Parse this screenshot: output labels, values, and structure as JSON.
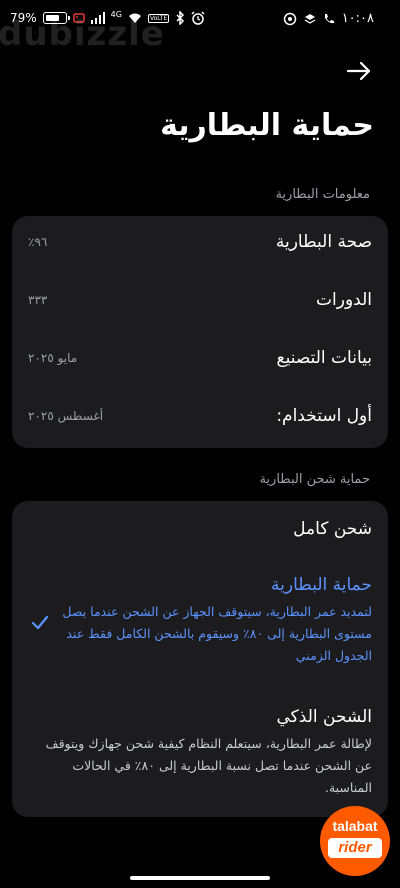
{
  "status": {
    "battery_percent": 79,
    "battery_label": "79%",
    "network_label": "4G",
    "volte_label": "VoLTE",
    "time": "١٠:٠٨",
    "icons": [
      "battery-icon",
      "battery-saver-icon",
      "gallery-icon",
      "signal-icon",
      "wifi-icon",
      "volte-icon",
      "bluetooth-icon",
      "alarm-icon",
      "whatsapp-icon",
      "layers-icon",
      "phone-icon"
    ]
  },
  "watermark": "dubizzle",
  "header": {
    "title": "حماية البطارية"
  },
  "battery_info": {
    "section_label": "معلومات البطارية",
    "rows": [
      {
        "label": "صحة البطارية",
        "value": "٩٦٪"
      },
      {
        "label": "الدورات",
        "value": "٣٣٣"
      },
      {
        "label": "بيانات التصنيع",
        "value": "مايو ٢٠٢٥"
      },
      {
        "label": "أول استخدام:",
        "value": "أغسطس ٢٠٢٥"
      }
    ]
  },
  "charging_protection": {
    "section_label": "حماية شحن البطارية",
    "options": [
      {
        "title": "شحن كامل",
        "desc_lines": []
      },
      {
        "title": "حماية البطارية",
        "selected": true,
        "desc_lines": [
          "لتمديد عمر البطارية، سيتوقف الجهاز عن الشحن عندما يصل",
          "مستوى البطارية إلى ٨٠٪ وسيقوم بالشحن الكامل فقط عند",
          "الجدول الزمني"
        ]
      },
      {
        "title": "الشحن الذكي",
        "desc_lines": [
          "لإطالة عمر البطارية، سيتعلم النظام كيفية شحن جهازك ويتوقف",
          "عن الشحن عندما تصل نسبة البطارية إلى ٨٠٪ في الحالات",
          "المناسبة."
        ]
      }
    ]
  },
  "overlay": {
    "brand_top": "talabat",
    "brand_bottom": "rider"
  },
  "colors": {
    "accent": "#5b93ff",
    "card": "#1c1c1e",
    "background": "#000000",
    "bubble": "#ff5a00"
  }
}
